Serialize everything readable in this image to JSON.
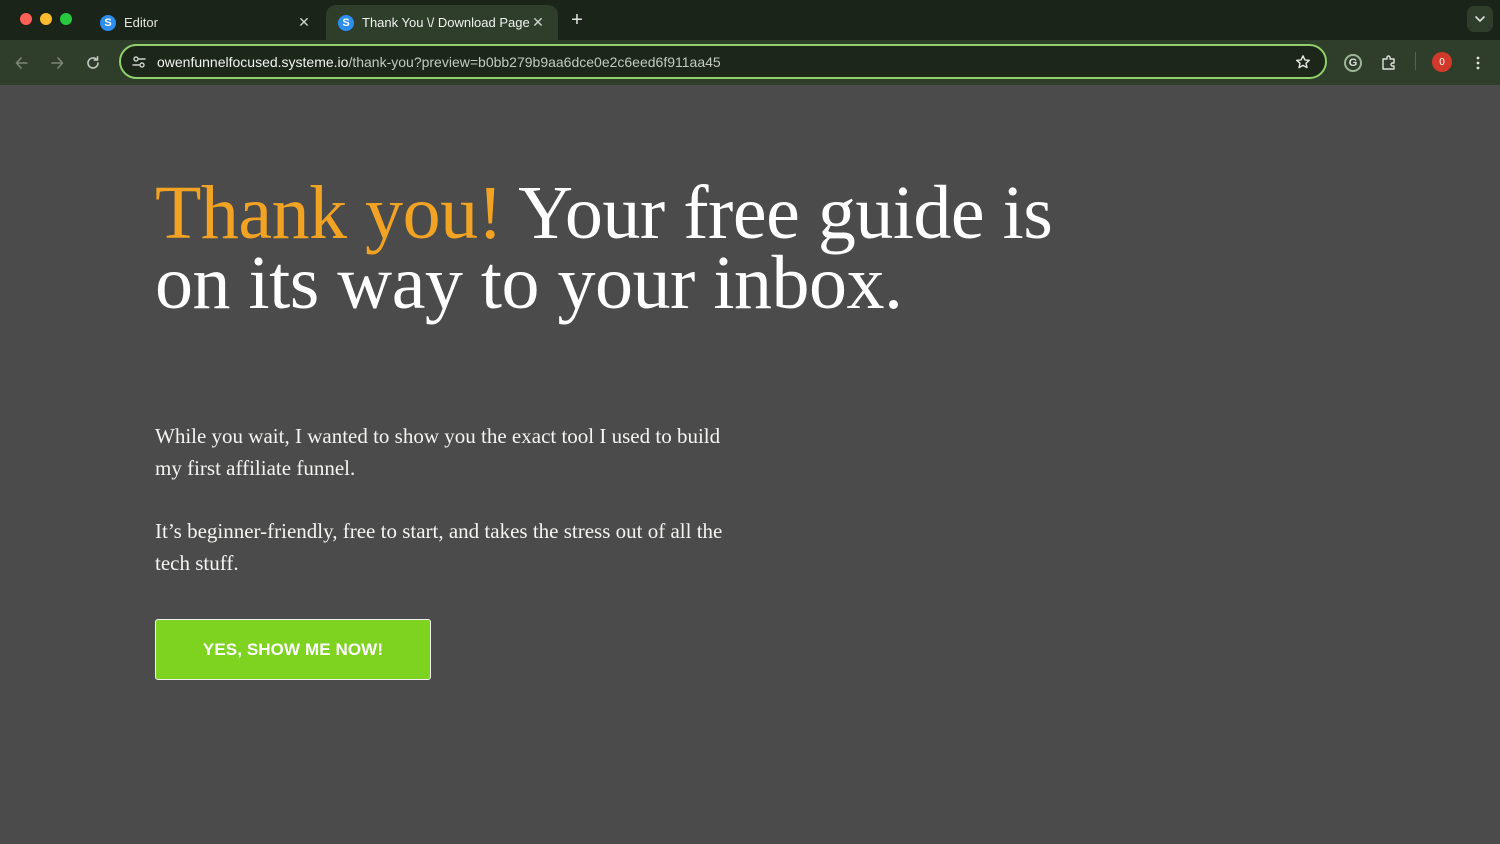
{
  "browser": {
    "tabs": [
      {
        "title": "Editor",
        "favicon": "S",
        "active": false
      },
      {
        "title": "Thank You \\/ Download Page",
        "favicon": "S",
        "active": true
      }
    ],
    "new_tab_glyph": "+",
    "close_glyph": "✕",
    "address": {
      "host": "owenfunnelfocused.systeme.io",
      "path": "/thank-you?preview=b0bb279b9aa6dce0e2c6eed6f911aa45"
    },
    "grammarly_glyph": "G",
    "profile_badge": "0",
    "colors": {
      "tab_strip": "#1a2418",
      "toolbar": "#2f3e2b",
      "omnibox_border": "#8fd06a"
    }
  },
  "page": {
    "headline_accent": "Thank you!",
    "headline_rest": " Your free guide is on its way to your inbox.",
    "paragraph_1": "While you wait, I wanted to show you the exact tool I used to build my first affiliate funnel.",
    "paragraph_2": "It’s beginner-friendly, free to start, and takes the stress out of all the tech stuff.",
    "cta_label": "YES, SHOW ME NOW!",
    "colors": {
      "background": "#4a4b4a",
      "accent": "#f3a323",
      "cta": "#7ed321"
    }
  }
}
